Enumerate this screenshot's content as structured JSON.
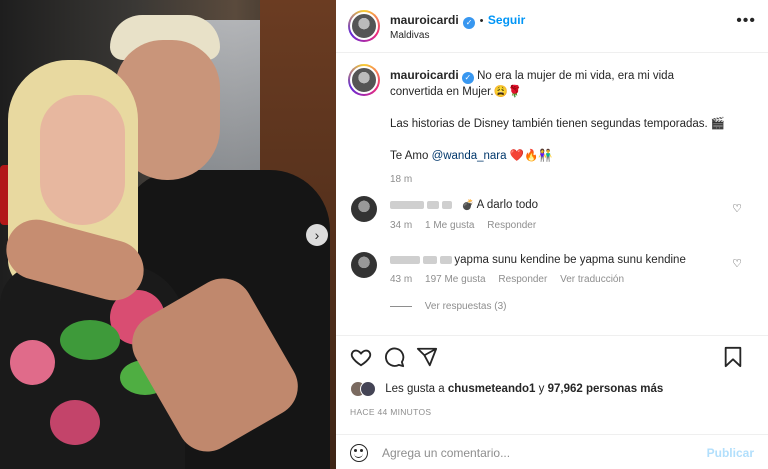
{
  "post": {
    "username": "mauroicardi",
    "follow_label": "Seguir",
    "location": "Maldivas",
    "more_label": "•••"
  },
  "caption": {
    "username": "mauroicardi",
    "line1": "No era la mujer de mi vida, era mi vida",
    "line2": "convertida en Mujer.",
    "line2_emoji": "😩🌹",
    "line3": "Las historias de Disney también tienen segundas temporadas.",
    "line3_emoji": "🎬",
    "line4_prefix": "Te Amo",
    "mention": "@wanda_nara",
    "line4_emoji": "❤️🔥👫",
    "time": "18 m"
  },
  "comments": [
    {
      "text": "A darlo todo",
      "prefix_emoji": "💣",
      "time": "34 m",
      "likes": "1 Me gusta",
      "reply": "Responder"
    },
    {
      "text": "yapma sunu kendine be yapma sunu kendine",
      "time": "43 m",
      "likes": "197 Me gusta",
      "reply": "Responder",
      "translate": "Ver traducción",
      "replies_label": "Ver respuestas (3)"
    }
  ],
  "likes": {
    "prefix": "Les gusta a",
    "user": "chusmeteando1",
    "middle": "y",
    "count": "97,962 personas más"
  },
  "time_ago": "HACE 44 MINUTOS",
  "comment_box": {
    "placeholder": "Agrega un comentario...",
    "publish_label": "Publicar"
  },
  "icons": {
    "like": "heart-icon",
    "comment": "comment-icon",
    "share": "share-icon",
    "save": "bookmark-icon",
    "next": "chevron-right-icon",
    "emoji": "emoji-icon"
  },
  "colors": {
    "link": "#0095f6",
    "verified": "#3897f0",
    "publish_disabled": "#b2dffc",
    "mention": "#00376b"
  }
}
